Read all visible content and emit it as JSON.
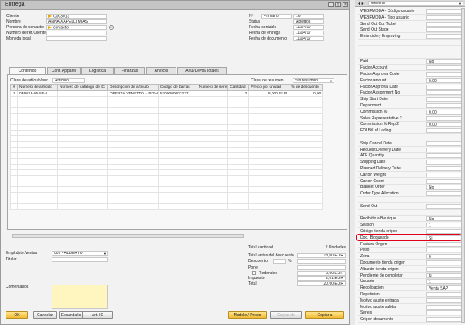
{
  "window": {
    "title": "Entrega"
  },
  "header_left": [
    {
      "label": "Cliente",
      "value": "C003013",
      "arrow": true
    },
    {
      "label": "Nombre",
      "value": "ANNA XAPELLI MIAS",
      "arrow": false
    },
    {
      "label": "Persona de contacto",
      "value": "contacto",
      "arrow": true
    },
    {
      "label": "Número de ref.Cliente",
      "value": "",
      "arrow": false
    },
    {
      "label": "Moneda local",
      "value": "",
      "arrow": false
    }
  ],
  "header_right": [
    {
      "label": "Nº",
      "value": "Primario",
      "value2": "16"
    },
    {
      "label": "Status",
      "value": "",
      "value2": "Abiertos"
    },
    {
      "label": "Fecha contable",
      "value": "",
      "value2": "11/04/17"
    },
    {
      "label": "Fecha de entrega",
      "value": "",
      "value2": "11/04/17"
    },
    {
      "label": "Fecha de documento",
      "value": "",
      "value2": "11/04/17"
    }
  ],
  "tabs": [
    "Contenido",
    "Cont. Apparel",
    "Logística",
    "Finanzas",
    "Anexos",
    "Anul/Devol/Totales"
  ],
  "grid": {
    "class_label": "Clase de artículo/ser",
    "class_value": "Artículo",
    "summary_label": "Clase de resumen",
    "summary_value": "Sin resumen",
    "columns": [
      "#",
      "Número de artículo",
      "Número de catálogo de IC",
      "Descripción de artículo",
      "Código de barras",
      "Número de serie",
      "Cantidad",
      "Precio por unidad",
      "% de descuento"
    ],
    "rows": [
      [
        "1",
        "0F6013-05-SB-U",
        "",
        "OPERTA VENETTO = POW",
        "5300000002227",
        "",
        "2",
        "9,000 EUR",
        "0,00"
      ]
    ]
  },
  "totals": [
    {
      "label": "Total cantidad",
      "value": "2 Unidades"
    },
    {
      "label": "Total antes del descuento",
      "value": "18,00 EUR"
    },
    {
      "label": "Descuento",
      "value": ""
    },
    {
      "label": "Porte",
      "value": ""
    },
    {
      "label": "Redondeo",
      "value": "0,00 EUR"
    },
    {
      "label": "Impuesto",
      "value": "2,01 EUR"
    },
    {
      "label": "Total",
      "value": "20,00 EUR"
    }
  ],
  "discount_pct_symbol": "%",
  "footer_left": [
    {
      "label": "Empl.dpto.Ventas",
      "value": "007 - ALBERTO"
    },
    {
      "label": "Titular",
      "value": ""
    }
  ],
  "comments_label": "Comentarios",
  "buttons": {
    "ok": "OK",
    "cancel": "Cancelar",
    "scan": "Escandallo",
    "art_ic": "Art. IC",
    "model_price": "Modelo / Precio",
    "copy_from": "Copiar de",
    "copy_to": "Copiar a"
  },
  "side_panel": {
    "header": "General",
    "rows": [
      {
        "label": "WEBFMODA - Código usuario",
        "value": ""
      },
      {
        "label": "WEBFMODA - Tipo usuario",
        "value": ""
      },
      {
        "label": "Send Out Cut Ticket",
        "value": ""
      },
      {
        "label": "Send Out Stage",
        "value": ""
      },
      {
        "label": "Embroidery Engraving",
        "value": ""
      },
      {
        "label": "",
        "value": ""
      },
      {
        "label": "",
        "value": ""
      },
      {
        "label": "",
        "value": ""
      },
      {
        "label": "Paid",
        "value": "No"
      },
      {
        "label": "Factor Account",
        "value": ""
      },
      {
        "label": "Factor Approval Code",
        "value": ""
      },
      {
        "label": "Factor amount",
        "value": "0,00"
      },
      {
        "label": "Factor Approval Date",
        "value": ""
      },
      {
        "label": "Factor Assignment No",
        "value": ""
      },
      {
        "label": "Ship Start Date",
        "value": ""
      },
      {
        "label": "Department",
        "value": ""
      },
      {
        "label": "Commission %",
        "value": "0,00"
      },
      {
        "label": "Sales Representative 2",
        "value": ""
      },
      {
        "label": "Commission % Rep 2",
        "value": "0,00"
      },
      {
        "label": "EDI Bill of Lading",
        "value": ""
      },
      {
        "label": "",
        "value": ""
      },
      {
        "label": "Ship Cancel Date",
        "value": ""
      },
      {
        "label": "Request Delivery Date",
        "value": ""
      },
      {
        "label": "ATP Quantity",
        "value": ""
      },
      {
        "label": "Shipping Date",
        "value": ""
      },
      {
        "label": "Planned Delivery Date",
        "value": ""
      },
      {
        "label": "Carton Weight",
        "value": ""
      },
      {
        "label": "Carton Count",
        "value": ""
      },
      {
        "label": "Blanket Order",
        "value": "No"
      },
      {
        "label": "Order Type Allocation",
        "value": ""
      },
      {
        "label": "",
        "value": ""
      },
      {
        "label": "Send Out",
        "value": ""
      },
      {
        "label": "",
        "value": ""
      },
      {
        "label": "Recibido a Boutique",
        "value": "No"
      },
      {
        "label": "Season",
        "value": "1"
      },
      {
        "label": "Código tienda origen",
        "value": ""
      },
      {
        "label": "Doc. Bloqueado",
        "value": "Si"
      },
      {
        "label": "Factura Origen",
        "value": ""
      },
      {
        "label": "Peso",
        "value": ""
      },
      {
        "label": "Zona",
        "value": "0"
      },
      {
        "label": "Documento tienda origen",
        "value": ""
      },
      {
        "label": "Albarán tienda origen",
        "value": ""
      },
      {
        "label": "Pendiente de completar",
        "value": "N"
      },
      {
        "label": "Usuario",
        "value": "1"
      },
      {
        "label": "Recolipación",
        "value": "Venta SAP"
      },
      {
        "label": "Repeticion",
        "value": ""
      },
      {
        "label": "Motivo ajuste entrada",
        "value": ""
      },
      {
        "label": "Motivo ajuste salida",
        "value": ""
      },
      {
        "label": "Series",
        "value": ""
      },
      {
        "label": "Origen documento",
        "value": ""
      }
    ],
    "highlight_label": "Doc. Bloqueado",
    "highlight_color": "#e0001b"
  }
}
